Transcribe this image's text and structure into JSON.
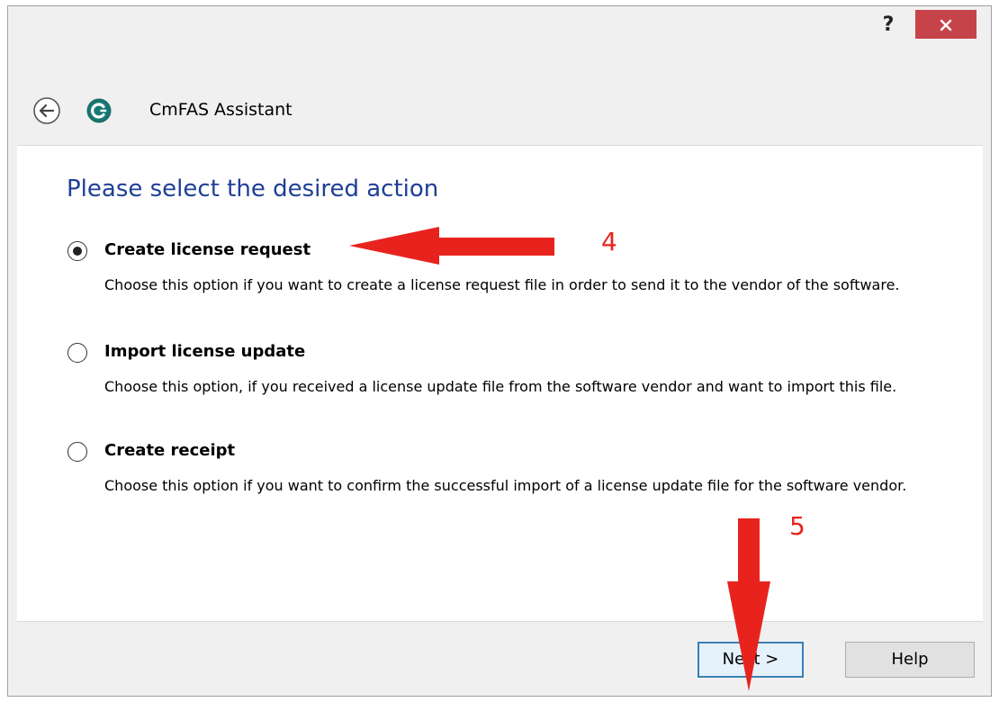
{
  "titlebar": {
    "help_glyph": "?",
    "close_icon": "close-icon"
  },
  "header": {
    "back_icon": "back-arrow-icon",
    "app_icon": "cmfas-app-icon",
    "title": "CmFAS Assistant"
  },
  "main": {
    "heading": "Please select the desired action",
    "options": [
      {
        "label": "Create license request",
        "description": "Choose this option if you want to create a license request file in order to send it to the vendor of the software.",
        "selected": true
      },
      {
        "label": "Import license update",
        "description": "Choose this option, if you received a license update file from the software vendor and want to import this file.",
        "selected": false
      },
      {
        "label": "Create receipt",
        "description": "Choose this option if you want to confirm the successful import of a license update file for the software vendor.",
        "selected": false
      }
    ]
  },
  "footer": {
    "next_label": "Next >",
    "help_label": "Help"
  },
  "annotations": {
    "step_4": "4",
    "step_5": "5",
    "arrow_color": "#e8231e"
  },
  "colors": {
    "heading": "#1e3f96",
    "close_button": "#c7434a"
  }
}
